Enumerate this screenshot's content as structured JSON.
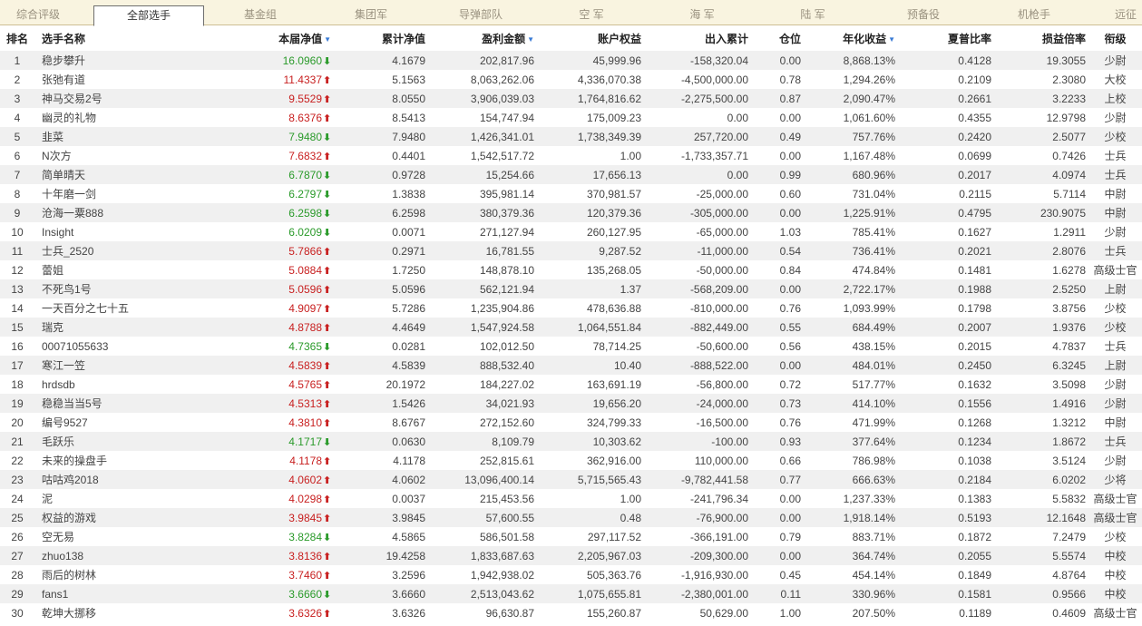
{
  "tabs": [
    {
      "label": "综合评级",
      "active": false
    },
    {
      "label": "全部选手",
      "active": true
    },
    {
      "label": "基金组",
      "active": false
    },
    {
      "label": "集团军",
      "active": false
    },
    {
      "label": "导弹部队",
      "active": false
    },
    {
      "label": "空  军",
      "active": false
    },
    {
      "label": "海  军",
      "active": false
    },
    {
      "label": "陆  军",
      "active": false
    },
    {
      "label": "预备役",
      "active": false
    },
    {
      "label": "机枪手",
      "active": false
    },
    {
      "label": "远征",
      "active": false
    }
  ],
  "headers": {
    "rank": "排名",
    "name": "选手名称",
    "nav": "本届净值",
    "cum_nav": "累计净值",
    "profit": "盈利金额",
    "equity": "账户权益",
    "inout": "出入累计",
    "position": "仓位",
    "annual": "年化收益",
    "sharpe": "夏普比率",
    "pl_ratio": "损益倍率",
    "title": "衔级"
  },
  "sort_icon": "triangle-down-icon",
  "colors": {
    "up": "#c82020",
    "down": "#2a9a2a",
    "sort": "#3a7bd5"
  },
  "rows": [
    {
      "rank": "1",
      "name": "稳步攀升",
      "nav": "16.0960",
      "dir": "down",
      "cum_nav": "4.1679",
      "profit": "202,817.96",
      "equity": "45,999.96",
      "inout": "-158,320.04",
      "position": "0.00",
      "annual": "8,868.13%",
      "sharpe": "0.4128",
      "pl_ratio": "19.3055",
      "title": "少尉"
    },
    {
      "rank": "2",
      "name": "张弛有道",
      "nav": "11.4337",
      "dir": "up",
      "cum_nav": "5.1563",
      "profit": "8,063,262.06",
      "equity": "4,336,070.38",
      "inout": "-4,500,000.00",
      "position": "0.78",
      "annual": "1,294.26%",
      "sharpe": "0.2109",
      "pl_ratio": "2.3080",
      "title": "大校"
    },
    {
      "rank": "3",
      "name": "神马交易2号",
      "nav": "9.5529",
      "dir": "up",
      "cum_nav": "8.0550",
      "profit": "3,906,039.03",
      "equity": "1,764,816.62",
      "inout": "-2,275,500.00",
      "position": "0.87",
      "annual": "2,090.47%",
      "sharpe": "0.2661",
      "pl_ratio": "3.2233",
      "title": "上校"
    },
    {
      "rank": "4",
      "name": "幽灵的礼物",
      "nav": "8.6376",
      "dir": "up",
      "cum_nav": "8.5413",
      "profit": "154,747.94",
      "equity": "175,009.23",
      "inout": "0.00",
      "position": "0.00",
      "annual": "1,061.60%",
      "sharpe": "0.4355",
      "pl_ratio": "12.9798",
      "title": "少尉"
    },
    {
      "rank": "5",
      "name": "韭菜",
      "nav": "7.9480",
      "dir": "down",
      "cum_nav": "7.9480",
      "profit": "1,426,341.01",
      "equity": "1,738,349.39",
      "inout": "257,720.00",
      "position": "0.49",
      "annual": "757.76%",
      "sharpe": "0.2420",
      "pl_ratio": "2.5077",
      "title": "少校"
    },
    {
      "rank": "6",
      "name": "N次方",
      "nav": "7.6832",
      "dir": "up",
      "cum_nav": "0.4401",
      "profit": "1,542,517.72",
      "equity": "1.00",
      "inout": "-1,733,357.71",
      "position": "0.00",
      "annual": "1,167.48%",
      "sharpe": "0.0699",
      "pl_ratio": "0.7426",
      "title": "士兵"
    },
    {
      "rank": "7",
      "name": "简单晴天",
      "nav": "6.7870",
      "dir": "down",
      "cum_nav": "0.9728",
      "profit": "15,254.66",
      "equity": "17,656.13",
      "inout": "0.00",
      "position": "0.99",
      "annual": "680.96%",
      "sharpe": "0.2017",
      "pl_ratio": "4.0974",
      "title": "士兵"
    },
    {
      "rank": "8",
      "name": "十年磨一剑",
      "nav": "6.2797",
      "dir": "down",
      "cum_nav": "1.3838",
      "profit": "395,981.14",
      "equity": "370,981.57",
      "inout": "-25,000.00",
      "position": "0.60",
      "annual": "731.04%",
      "sharpe": "0.2115",
      "pl_ratio": "5.7114",
      "title": "中尉"
    },
    {
      "rank": "9",
      "name": "沧海一粟888",
      "nav": "6.2598",
      "dir": "down",
      "cum_nav": "6.2598",
      "profit": "380,379.36",
      "equity": "120,379.36",
      "inout": "-305,000.00",
      "position": "0.00",
      "annual": "1,225.91%",
      "sharpe": "0.4795",
      "pl_ratio": "230.9075",
      "title": "中尉"
    },
    {
      "rank": "10",
      "name": "Insight",
      "nav": "6.0209",
      "dir": "down",
      "cum_nav": "0.0071",
      "profit": "271,127.94",
      "equity": "260,127.95",
      "inout": "-65,000.00",
      "position": "1.03",
      "annual": "785.41%",
      "sharpe": "0.1627",
      "pl_ratio": "1.2911",
      "title": "少尉"
    },
    {
      "rank": "11",
      "name": "士兵_2520",
      "nav": "5.7866",
      "dir": "up",
      "cum_nav": "0.2971",
      "profit": "16,781.55",
      "equity": "9,287.52",
      "inout": "-11,000.00",
      "position": "0.54",
      "annual": "736.41%",
      "sharpe": "0.2021",
      "pl_ratio": "2.8076",
      "title": "士兵"
    },
    {
      "rank": "12",
      "name": "蕾姐",
      "nav": "5.0884",
      "dir": "up",
      "cum_nav": "1.7250",
      "profit": "148,878.10",
      "equity": "135,268.05",
      "inout": "-50,000.00",
      "position": "0.84",
      "annual": "474.84%",
      "sharpe": "0.1481",
      "pl_ratio": "1.6278",
      "title": "高级士官"
    },
    {
      "rank": "13",
      "name": "不死鸟1号",
      "nav": "5.0596",
      "dir": "up",
      "cum_nav": "5.0596",
      "profit": "562,121.94",
      "equity": "1.37",
      "inout": "-568,209.00",
      "position": "0.00",
      "annual": "2,722.17%",
      "sharpe": "0.1988",
      "pl_ratio": "2.5250",
      "title": "上尉"
    },
    {
      "rank": "14",
      "name": "一天百分之七十五",
      "nav": "4.9097",
      "dir": "up",
      "cum_nav": "5.7286",
      "profit": "1,235,904.86",
      "equity": "478,636.88",
      "inout": "-810,000.00",
      "position": "0.76",
      "annual": "1,093.99%",
      "sharpe": "0.1798",
      "pl_ratio": "3.8756",
      "title": "少校"
    },
    {
      "rank": "15",
      "name": "瑞克",
      "nav": "4.8788",
      "dir": "up",
      "cum_nav": "4.4649",
      "profit": "1,547,924.58",
      "equity": "1,064,551.84",
      "inout": "-882,449.00",
      "position": "0.55",
      "annual": "684.49%",
      "sharpe": "0.2007",
      "pl_ratio": "1.9376",
      "title": "少校"
    },
    {
      "rank": "16",
      "name": "00071055633",
      "nav": "4.7365",
      "dir": "down",
      "cum_nav": "0.0281",
      "profit": "102,012.50",
      "equity": "78,714.25",
      "inout": "-50,600.00",
      "position": "0.56",
      "annual": "438.15%",
      "sharpe": "0.2015",
      "pl_ratio": "4.7837",
      "title": "士兵"
    },
    {
      "rank": "17",
      "name": "寒江一笠",
      "nav": "4.5839",
      "dir": "up",
      "cum_nav": "4.5839",
      "profit": "888,532.40",
      "equity": "10.40",
      "inout": "-888,522.00",
      "position": "0.00",
      "annual": "484.01%",
      "sharpe": "0.2450",
      "pl_ratio": "6.3245",
      "title": "上尉"
    },
    {
      "rank": "18",
      "name": "hrdsdb",
      "nav": "4.5765",
      "dir": "up",
      "cum_nav": "20.1972",
      "profit": "184,227.02",
      "equity": "163,691.19",
      "inout": "-56,800.00",
      "position": "0.72",
      "annual": "517.77%",
      "sharpe": "0.1632",
      "pl_ratio": "3.5098",
      "title": "少尉"
    },
    {
      "rank": "19",
      "name": "稳稳当当5号",
      "nav": "4.5313",
      "dir": "up",
      "cum_nav": "1.5426",
      "profit": "34,021.93",
      "equity": "19,656.20",
      "inout": "-24,000.00",
      "position": "0.73",
      "annual": "414.10%",
      "sharpe": "0.1556",
      "pl_ratio": "1.4916",
      "title": "少尉"
    },
    {
      "rank": "20",
      "name": "编号9527",
      "nav": "4.3810",
      "dir": "up",
      "cum_nav": "8.6767",
      "profit": "272,152.60",
      "equity": "324,799.33",
      "inout": "-16,500.00",
      "position": "0.76",
      "annual": "471.99%",
      "sharpe": "0.1268",
      "pl_ratio": "1.3212",
      "title": "中尉"
    },
    {
      "rank": "21",
      "name": "毛跃乐",
      "nav": "4.1717",
      "dir": "down",
      "cum_nav": "0.0630",
      "profit": "8,109.79",
      "equity": "10,303.62",
      "inout": "-100.00",
      "position": "0.93",
      "annual": "377.64%",
      "sharpe": "0.1234",
      "pl_ratio": "1.8672",
      "title": "士兵"
    },
    {
      "rank": "22",
      "name": "未来的操盘手",
      "nav": "4.1178",
      "dir": "up",
      "cum_nav": "4.1178",
      "profit": "252,815.61",
      "equity": "362,916.00",
      "inout": "110,000.00",
      "position": "0.66",
      "annual": "786.98%",
      "sharpe": "0.1038",
      "pl_ratio": "3.5124",
      "title": "少尉"
    },
    {
      "rank": "23",
      "name": "咕咕鸡2018",
      "nav": "4.0602",
      "dir": "up",
      "cum_nav": "4.0602",
      "profit": "13,096,400.14",
      "equity": "5,715,565.43",
      "inout": "-9,782,441.58",
      "position": "0.77",
      "annual": "666.63%",
      "sharpe": "0.2184",
      "pl_ratio": "6.0202",
      "title": "少将"
    },
    {
      "rank": "24",
      "name": "泥",
      "nav": "4.0298",
      "dir": "up",
      "cum_nav": "0.0037",
      "profit": "215,453.56",
      "equity": "1.00",
      "inout": "-241,796.34",
      "position": "0.00",
      "annual": "1,237.33%",
      "sharpe": "0.1383",
      "pl_ratio": "5.5832",
      "title": "高级士官"
    },
    {
      "rank": "25",
      "name": "权益的游戏",
      "nav": "3.9845",
      "dir": "up",
      "cum_nav": "3.9845",
      "profit": "57,600.55",
      "equity": "0.48",
      "inout": "-76,900.00",
      "position": "0.00",
      "annual": "1,918.14%",
      "sharpe": "0.5193",
      "pl_ratio": "12.1648",
      "title": "高级士官"
    },
    {
      "rank": "26",
      "name": "空无易",
      "nav": "3.8284",
      "dir": "down",
      "cum_nav": "4.5865",
      "profit": "586,501.58",
      "equity": "297,117.52",
      "inout": "-366,191.00",
      "position": "0.79",
      "annual": "883.71%",
      "sharpe": "0.1872",
      "pl_ratio": "7.2479",
      "title": "少校"
    },
    {
      "rank": "27",
      "name": "zhuo138",
      "nav": "3.8136",
      "dir": "up",
      "cum_nav": "19.4258",
      "profit": "1,833,687.63",
      "equity": "2,205,967.03",
      "inout": "-209,300.00",
      "position": "0.00",
      "annual": "364.74%",
      "sharpe": "0.2055",
      "pl_ratio": "5.5574",
      "title": "中校"
    },
    {
      "rank": "28",
      "name": "雨后的树林",
      "nav": "3.7460",
      "dir": "up",
      "cum_nav": "3.2596",
      "profit": "1,942,938.02",
      "equity": "505,363.76",
      "inout": "-1,916,930.00",
      "position": "0.45",
      "annual": "454.14%",
      "sharpe": "0.1849",
      "pl_ratio": "4.8764",
      "title": "中校"
    },
    {
      "rank": "29",
      "name": "fans1",
      "nav": "3.6660",
      "dir": "down",
      "cum_nav": "3.6660",
      "profit": "2,513,043.62",
      "equity": "1,075,655.81",
      "inout": "-2,380,001.00",
      "position": "0.11",
      "annual": "330.96%",
      "sharpe": "0.1581",
      "pl_ratio": "0.9566",
      "title": "中校"
    },
    {
      "rank": "30",
      "name": "乾坤大挪移",
      "nav": "3.6326",
      "dir": "up",
      "cum_nav": "3.6326",
      "profit": "96,630.87",
      "equity": "155,260.87",
      "inout": "50,629.00",
      "position": "1.00",
      "annual": "207.50%",
      "sharpe": "0.1189",
      "pl_ratio": "0.4609",
      "title": "高级士官"
    }
  ]
}
